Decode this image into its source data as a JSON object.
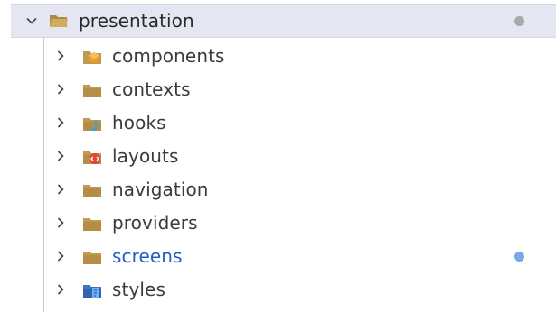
{
  "explorer": {
    "root": {
      "label": "presentation",
      "expanded": true,
      "icon": "folder-open-icon",
      "status_dot_color": "#a9a9a9"
    },
    "children": [
      {
        "label": "components",
        "icon": "folder-components-icon",
        "modified": false
      },
      {
        "label": "contexts",
        "icon": "folder-icon",
        "modified": false
      },
      {
        "label": "hooks",
        "icon": "folder-hooks-icon",
        "modified": false
      },
      {
        "label": "layouts",
        "icon": "folder-layouts-icon",
        "modified": false
      },
      {
        "label": "navigation",
        "icon": "folder-icon",
        "modified": false
      },
      {
        "label": "providers",
        "icon": "folder-icon",
        "modified": false
      },
      {
        "label": "screens",
        "icon": "folder-icon",
        "modified": true,
        "status_dot_color": "#7aa7e6"
      },
      {
        "label": "styles",
        "icon": "folder-styles-icon",
        "modified": false
      }
    ]
  },
  "colors": {
    "folder": "#c09a4f",
    "folder_dark": "#a8843f",
    "modified_text": "#1f5fc4",
    "selection_bg": "#e4e6f1"
  }
}
